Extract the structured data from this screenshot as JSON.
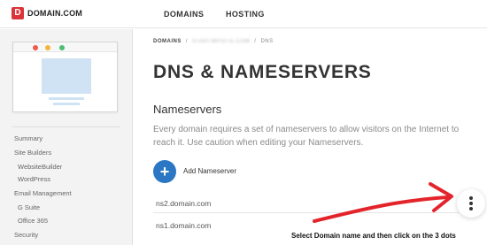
{
  "header": {
    "logo_letter": "D",
    "logo_text": "DOMAIN.COM",
    "nav": [
      "DOMAINS",
      "HOSTING"
    ]
  },
  "sidebar": {
    "items": [
      {
        "label": "Summary",
        "level": "main"
      },
      {
        "label": "Site Builders",
        "level": "main"
      },
      {
        "label": "WebsiteBuilder",
        "level": "sub"
      },
      {
        "label": "WordPress",
        "level": "sub"
      },
      {
        "label": "Email Management",
        "level": "main"
      },
      {
        "label": "G Suite",
        "level": "sub"
      },
      {
        "label": "Office 365",
        "level": "sub"
      },
      {
        "label": "Security",
        "level": "main"
      }
    ]
  },
  "breadcrumb": {
    "root": "DOMAINS",
    "domain": "STARTWPSITE.COM",
    "current": "DNS"
  },
  "main": {
    "title": "DNS & NAMESERVERS",
    "section_title": "Nameservers",
    "description": "Every domain requires a set of nameservers to allow visitors on the Internet to reach it. Use caution when editing your Nameservers.",
    "add_label": "Add Nameserver",
    "nameservers": [
      "ns2.domain.com",
      "ns1.domain.com"
    ]
  },
  "annotation": {
    "instruction": "Select Domain name and then click on the 3 dots",
    "arrow_color": "#e3242b"
  },
  "colors": {
    "brand_red": "#d9353a",
    "accent_blue": "#2b77c4"
  }
}
